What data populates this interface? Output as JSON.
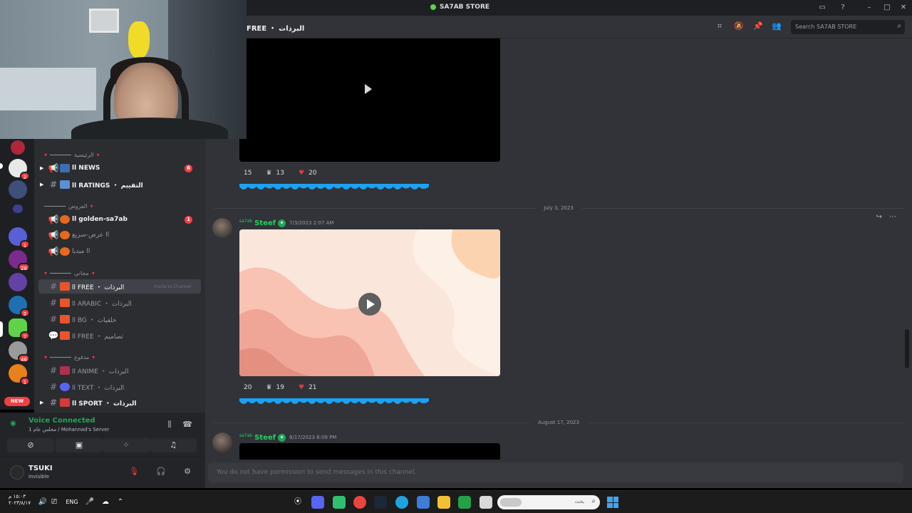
{
  "window": {
    "title": "SA7AB STORE",
    "controls": [
      "inbox-icon",
      "help-icon",
      "minimize-icon",
      "maximize-icon",
      "close-icon"
    ]
  },
  "channel_header": {
    "name": "FREE ・ البرذات",
    "search_placeholder": "Search SA7AB STORE"
  },
  "server_rail": {
    "badges": [
      "2",
      "1",
      "28",
      "2",
      "7",
      "46",
      "1"
    ],
    "new_label": "NEW"
  },
  "sidebar": {
    "categories": [
      "الرئيسية",
      "العروض",
      "مجاني",
      "مدفوع"
    ],
    "channels": [
      {
        "label": "ll NEWS",
        "mention": "6"
      },
      {
        "label": "ll RATINGS ・ التقييم"
      },
      {
        "label": "ll golden-sa7ab",
        "mention": "1"
      },
      {
        "label": "عرض-سريع ll"
      },
      {
        "label": "ميديا ll"
      },
      {
        "label": "ll FREE ・ البرذات",
        "invite": "Invite to Channel"
      },
      {
        "label": "ll ARABIC ・ البرذات"
      },
      {
        "label": "ll BG ・ خلفيات"
      },
      {
        "label": "ll FREE ・ تصاميم"
      },
      {
        "label": "ll ANIME ・ البرذات"
      },
      {
        "label": "ll TEXT ・ البرذات"
      },
      {
        "label": "ll SPORT ・ البرذات"
      }
    ]
  },
  "voice": {
    "title": "Voice Connected",
    "subtitle": "مجلس عام 1 / Mohannad's Server"
  },
  "user": {
    "name": "TSUKI",
    "status": "Invisible"
  },
  "messages": [
    {
      "reactions": [
        "15",
        "13",
        "20"
      ]
    },
    {
      "date": "July 3, 2023",
      "tag": "sa7ab",
      "author": "Steef",
      "time": "7/3/2023 2:07 AM",
      "reactions": [
        "20",
        "19",
        "21"
      ]
    },
    {
      "date": "August 17, 2023",
      "tag": "sa7ab",
      "author": "Steef",
      "time": "8/17/2023 8:09 PM"
    }
  ],
  "composer": {
    "placeholder": "You do not have permission to send messages in this channel."
  },
  "taskbar": {
    "time": "١٥:٠٣ م",
    "date": "٢٠٢٣/٨/١٧",
    "lang": "ENG",
    "search": "بحث"
  },
  "colors": {
    "accent_green": "#23d160",
    "mention_red": "#f23f43",
    "bg_chat": "#313338",
    "bg_sidebar": "#2b2d31"
  }
}
